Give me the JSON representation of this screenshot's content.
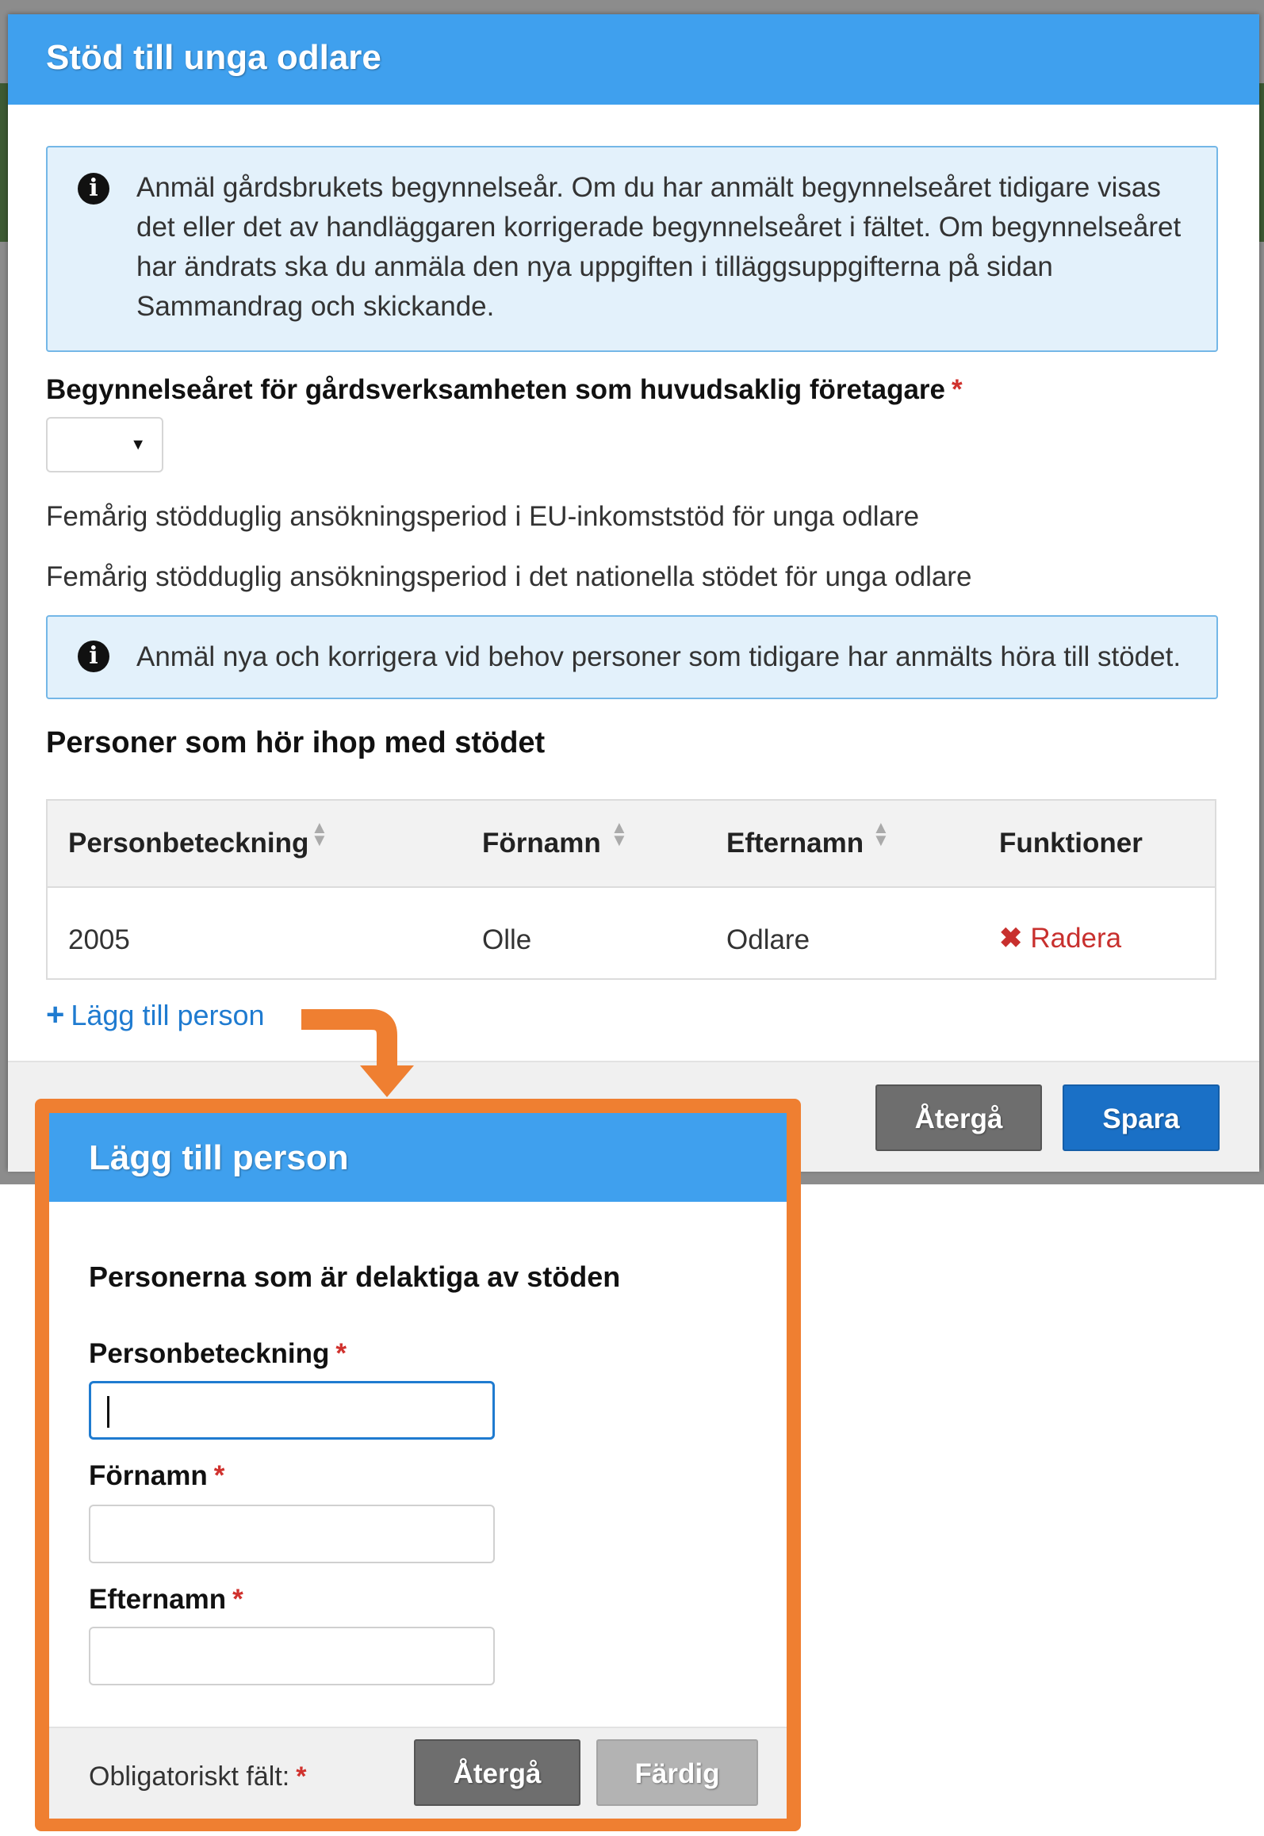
{
  "main_dialog": {
    "title": "Stöd till unga odlare",
    "info_1": "Anmäl gårdsbrukets begynnelseår. Om du har anmält begynnelseåret tidigare visas det eller det av handläggaren korrigerade begynnelseåret i fältet. Om begynnelseåret har ändrats ska du anmäla den nya uppgiften i tilläggsuppgifterna på sidan Sammandrag och skickande.",
    "year_label": "Begynnelseåret för gårdsverksamheten som huvudsaklig företagare",
    "required_mark": "*",
    "year_select_value": "",
    "text_eu_period": "Femårig stödduglig ansökningsperiod i EU-inkomststöd för unga odlare",
    "text_national_period": "Femårig stödduglig ansökningsperiod i det nationella stödet för unga odlare",
    "info_2": "Anmäl nya och korrigera vid behov personer som tidigare har anmälts höra till stödet.",
    "persons_title": "Personer som hör ihop med stödet",
    "table": {
      "columns": [
        "Personbeteckning",
        "Förnamn",
        "Efternamn",
        "Funktioner"
      ],
      "rows": [
        {
          "personbeteckning": "2005",
          "fornamn": "Olle",
          "efternamn": "Odlare",
          "action": "Radera"
        }
      ]
    },
    "add_person_link": "Lägg till person",
    "cancel_button": "Återgå",
    "save_button": "Spara"
  },
  "sub_dialog": {
    "title": "Lägg till person",
    "section_title": "Personerna som är delaktiga av stöden",
    "field_personbeteckning_label": "Personbeteckning",
    "field_personbeteckning_value": "",
    "field_fornamn_label": "Förnamn",
    "field_fornamn_value": "",
    "field_efternamn_label": "Efternamn",
    "field_efternamn_value": "",
    "mandatory_note": "Obligatoriskt fält:",
    "cancel_button": "Återgå",
    "done_button": "Färdig"
  },
  "icons": {
    "info": "info-icon",
    "sort": "sort-icon",
    "delete": "close-icon",
    "add": "plus-icon",
    "select_caret": "caret-down-icon"
  },
  "colors": {
    "header_blue": "#3fa0ee",
    "primary_blue": "#1a70c6",
    "link_blue": "#1f7bd0",
    "danger_red": "#c8302e",
    "callout_orange": "#ef7f31"
  }
}
